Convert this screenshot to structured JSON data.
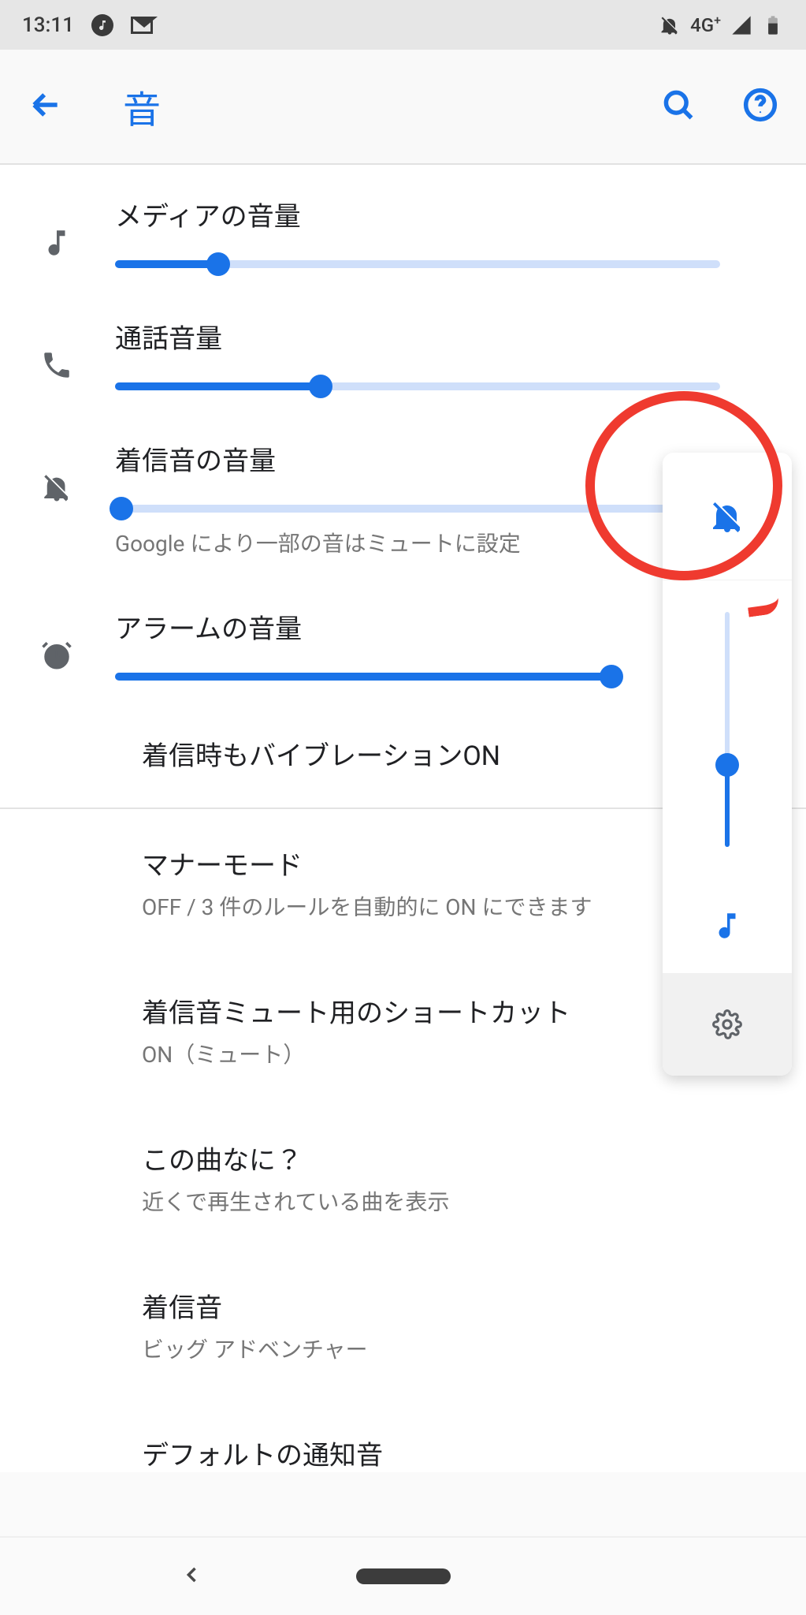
{
  "status_bar": {
    "time": "13:11",
    "network_label": "4G",
    "network_plus": "+"
  },
  "app_bar": {
    "title": "音"
  },
  "sliders": {
    "media": {
      "label": "メディアの音量",
      "value": 17
    },
    "call": {
      "label": "通話音量",
      "value": 34
    },
    "ring": {
      "label": "着信音の音量",
      "value": 0,
      "sub": "Google により一部の音はミュートに設定"
    },
    "alarm": {
      "label": "アラームの音量",
      "value": 100
    }
  },
  "prefs": {
    "vibrate": {
      "title": "着信時もバイブレーションON"
    },
    "dnd": {
      "title": "マナーモード",
      "sub": "OFF / 3 件のルールを自動的に ON にできます"
    },
    "shortcut": {
      "title": "着信音ミュート用のショートカット",
      "sub": "ON（ミュート）"
    },
    "nowplaying": {
      "title": "この曲なに？",
      "sub": "近くで再生されている曲を表示"
    },
    "ringtone": {
      "title": "着信音",
      "sub": "ビッグ アドベンチャー"
    },
    "notif": {
      "title": "デフォルトの通知音"
    }
  },
  "volume_panel": {
    "value": 35
  },
  "colors": {
    "accent": "#1a73e8",
    "text": "#202124",
    "subtext": "#767676",
    "annotation": "#ef3a2f"
  }
}
